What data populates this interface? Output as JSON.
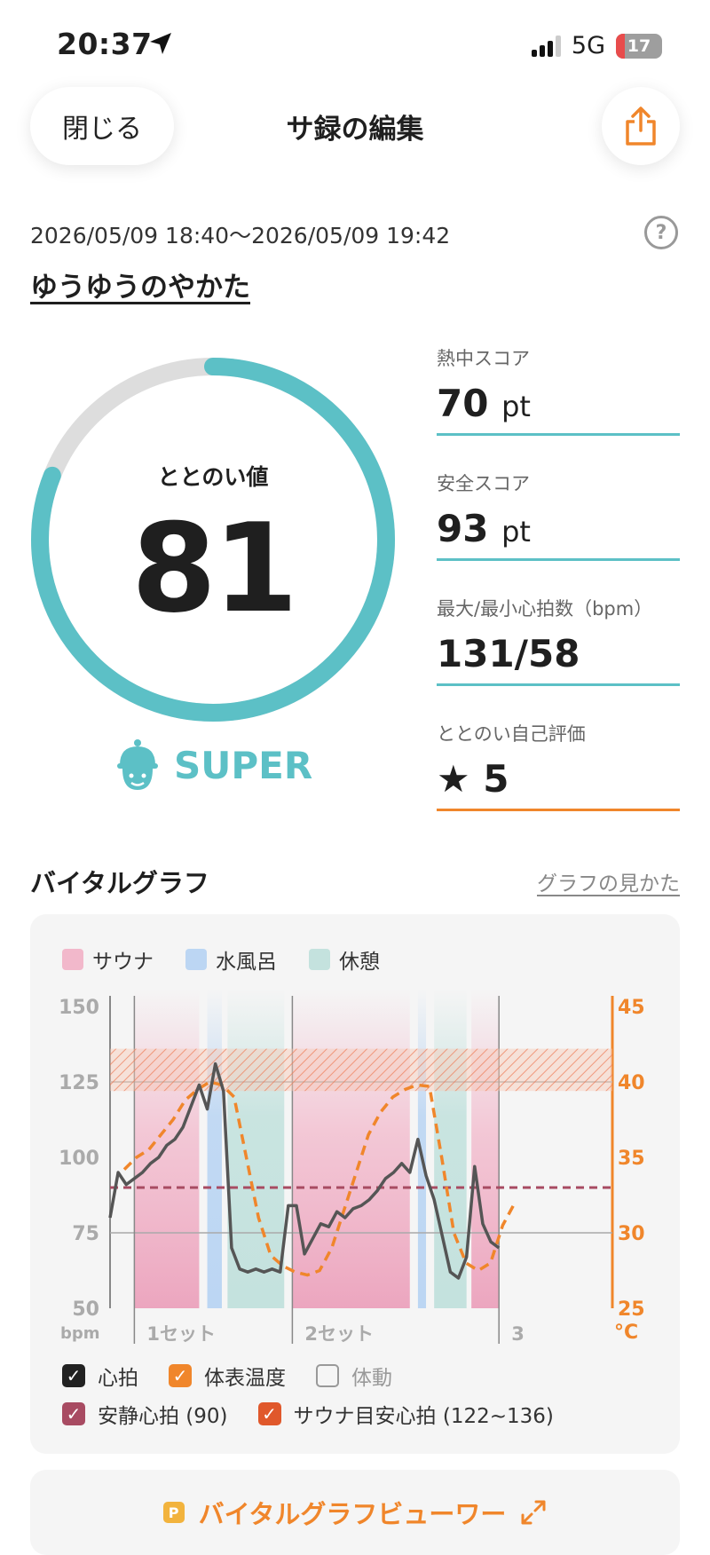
{
  "status_bar": {
    "time": "20:37",
    "network": "5G",
    "battery": "17"
  },
  "header": {
    "close_label": "閉じる",
    "title": "サ録の編集"
  },
  "session": {
    "date_range": "2026/05/09 18:40～2026/05/09 19:42",
    "facility": "ゆうゆうのやかた"
  },
  "totonoi": {
    "label": "ととのい値",
    "value": "81",
    "rank": "SUPER",
    "ring_fraction": 0.81,
    "color": "#5cc0c6"
  },
  "stats": [
    {
      "label": "熱中スコア",
      "value": "70",
      "unit": "pt"
    },
    {
      "label": "安全スコア",
      "value": "93",
      "unit": "pt"
    },
    {
      "label": "最大/最小心拍数（bpm）",
      "value": "131/58",
      "unit": ""
    },
    {
      "label": "ととのい自己評価",
      "value": "★ 5",
      "unit": ""
    }
  ],
  "vital": {
    "title": "バイタルグラフ",
    "howto": "グラフの見かた",
    "legend": [
      {
        "label": "サウナ",
        "color": "#f2b8cb"
      },
      {
        "label": "水風呂",
        "color": "#bcd6f3"
      },
      {
        "label": "休憩",
        "color": "#c4e2de"
      }
    ],
    "checks": [
      {
        "label": "心拍",
        "checked": true,
        "color": "#222222"
      },
      {
        "label": "体表温度",
        "checked": true,
        "color": "#f0862b"
      },
      {
        "label": "体動",
        "checked": false,
        "color": "#999999"
      },
      {
        "label": "安静心拍 (90)",
        "checked": true,
        "color": "#a84b62"
      },
      {
        "label": "サウナ目安心拍 (122~136)",
        "checked": true,
        "color": "#e0582b"
      }
    ],
    "viewer_button": "バイタルグラフビューワー"
  },
  "chart_data": {
    "type": "line",
    "title": "",
    "xlabel": "",
    "ylabel": "bpm",
    "y2label": "°C",
    "ylim": [
      50,
      150
    ],
    "y_ticks": [
      "150",
      "125",
      "100",
      "75",
      "50"
    ],
    "y2lim": [
      25,
      45
    ],
    "y2_ticks": [
      "45",
      "40",
      "35",
      "30",
      "25"
    ],
    "x": [
      0,
      1,
      2,
      3,
      4,
      5,
      6,
      7,
      8,
      9,
      10,
      11,
      12,
      13,
      14,
      15,
      16,
      17,
      18,
      19,
      20,
      21,
      22,
      23,
      24,
      25,
      26,
      27,
      28,
      29,
      30,
      31,
      32,
      33,
      34,
      35,
      36,
      37,
      38,
      39,
      40,
      41,
      42,
      43,
      44,
      45,
      46,
      47,
      48,
      49,
      50,
      51,
      52,
      53,
      54,
      55,
      56,
      57,
      58,
      59,
      60,
      61,
      62
    ],
    "sets": [
      "1セット",
      "2セット",
      "3セット"
    ],
    "phases": [
      {
        "type": "サウナ",
        "start": 3,
        "end": 11
      },
      {
        "type": "水風呂",
        "start": 12,
        "end": 13.8
      },
      {
        "type": "休憩",
        "start": 14.5,
        "end": 21.5
      },
      {
        "type": "サウナ",
        "start": 22.5,
        "end": 37
      },
      {
        "type": "水風呂",
        "start": 38,
        "end": 39
      },
      {
        "type": "休憩",
        "start": 40,
        "end": 44
      },
      {
        "type": "サウナ",
        "start": 44.6,
        "end": 48
      }
    ],
    "resting_hr": 90,
    "sauna_target_hr": [
      122,
      136
    ],
    "series": [
      {
        "name": "心拍",
        "axis": "left",
        "color": "#555555",
        "values": [
          80,
          95,
          91,
          93,
          95,
          98,
          100,
          104,
          106,
          110,
          117,
          124,
          116,
          131,
          122,
          70,
          63,
          62,
          63,
          62,
          63,
          62,
          84,
          84,
          68,
          73,
          78,
          77,
          82,
          80,
          83,
          84,
          86,
          89,
          93,
          95,
          98,
          95,
          106,
          94,
          86,
          74,
          62,
          60,
          67,
          97,
          78,
          72,
          70
        ]
      },
      {
        "name": "体表温度",
        "axis": "right",
        "color": "#f0862b",
        "values": [
          34.2,
          35,
          35.5,
          36.5,
          37.5,
          38.8,
          39.5,
          40,
          39.8,
          39,
          35,
          31,
          28.5,
          27.8,
          27.4,
          27.2,
          27.5,
          29,
          31.5,
          34,
          36.5,
          38,
          39,
          39.5,
          39.8,
          39.7,
          35,
          30,
          28,
          27.5,
          28,
          30.5,
          32
        ]
      }
    ]
  }
}
